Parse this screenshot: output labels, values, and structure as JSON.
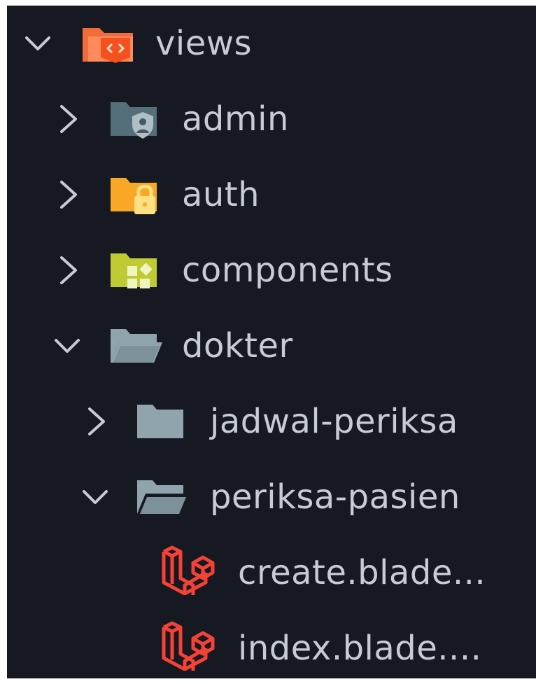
{
  "tree": {
    "views": {
      "label": "views",
      "expanded": true,
      "icon": "folder-views-icon"
    },
    "admin": {
      "label": "admin",
      "expanded": false,
      "icon": "folder-admin-icon"
    },
    "auth": {
      "label": "auth",
      "expanded": false,
      "icon": "folder-auth-icon"
    },
    "components": {
      "label": "components",
      "expanded": false,
      "icon": "folder-components-icon"
    },
    "dokter": {
      "label": "dokter",
      "expanded": true,
      "icon": "folder-open-icon"
    },
    "jadwal_periksa": {
      "label": "jadwal-periksa",
      "expanded": false,
      "icon": "folder-icon"
    },
    "periksa_pasien": {
      "label": "periksa-pasien",
      "expanded": true,
      "icon": "folder-open-icon"
    },
    "create_file": {
      "label": "create.blade...",
      "icon": "laravel-icon"
    },
    "index_file": {
      "label": "index.blade....",
      "icon": "laravel-icon"
    }
  },
  "colors": {
    "background": "#161922",
    "text": "#c7cbd2",
    "chevron": "#c7cbd2",
    "views_folder": "#f26b3a",
    "admin_folder": "#546e7a",
    "auth_folder": "#f9a825",
    "components_folder": "#c0ca33",
    "plain_folder": "#90a4ae",
    "laravel_red": "#f44336"
  }
}
